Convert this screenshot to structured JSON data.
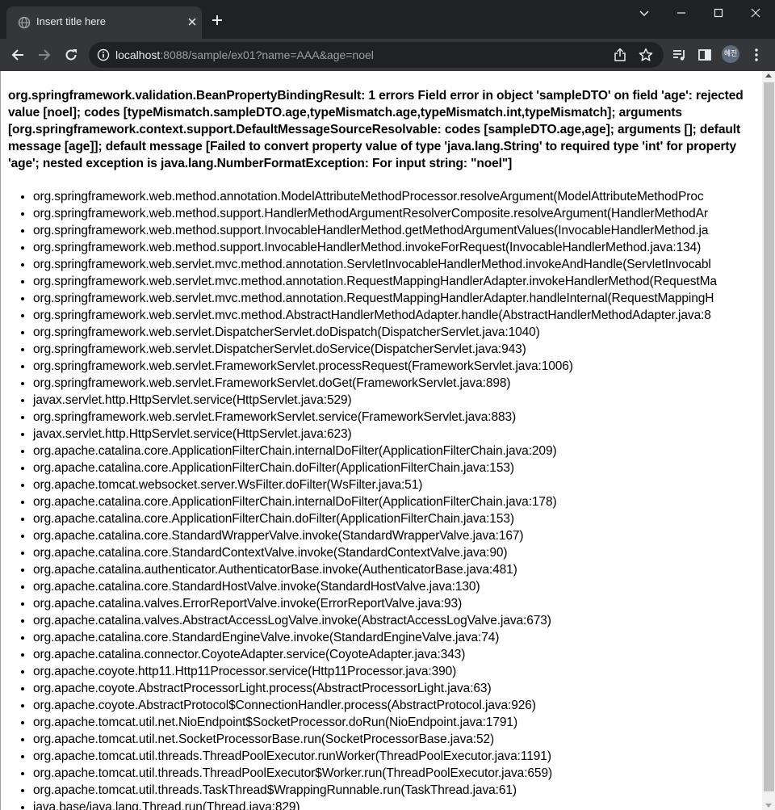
{
  "tab": {
    "title": "Insert title here",
    "favicon": "globe-icon"
  },
  "window_controls": [
    "chevron-down-icon",
    "minimize-icon",
    "maximize-icon",
    "close-icon"
  ],
  "address_bar": {
    "host": "localhost",
    "rest": ":8088/sample/ex01?name=AAA&age=noel"
  },
  "profile": {
    "initials": "혜진"
  },
  "colors": {
    "tabstrip": "#202124",
    "toolbar": "#35363a",
    "omnibox": "#202124",
    "text_light": "#e8eaed",
    "text_dim": "#9aa0a6"
  },
  "error": {
    "message": "org.springframework.validation.BeanPropertyBindingResult: 1 errors Field error in object 'sampleDTO' on field 'age': rejected value [noel]; codes [typeMismatch.sampleDTO.age,typeMismatch.age,typeMismatch.int,typeMismatch]; arguments [org.springframework.context.support.DefaultMessageSourceResolvable: codes [sampleDTO.age,age]; arguments []; default message [age]]; default message [Failed to convert property value of type 'java.lang.String' to required type 'int' for property 'age'; nested exception is java.lang.NumberFormatException: For input string: \"noel\"]"
  },
  "trace": [
    "org.springframework.web.method.annotation.ModelAttributeMethodProcessor.resolveArgument(ModelAttributeMethodProc",
    "org.springframework.web.method.support.HandlerMethodArgumentResolverComposite.resolveArgument(HandlerMethodAr",
    "org.springframework.web.method.support.InvocableHandlerMethod.getMethodArgumentValues(InvocableHandlerMethod.ja",
    "org.springframework.web.method.support.InvocableHandlerMethod.invokeForRequest(InvocableHandlerMethod.java:134)",
    "org.springframework.web.servlet.mvc.method.annotation.ServletInvocableHandlerMethod.invokeAndHandle(ServletInvocabl",
    "org.springframework.web.servlet.mvc.method.annotation.RequestMappingHandlerAdapter.invokeHandlerMethod(RequestMa",
    "org.springframework.web.servlet.mvc.method.annotation.RequestMappingHandlerAdapter.handleInternal(RequestMappingH",
    "org.springframework.web.servlet.mvc.method.AbstractHandlerMethodAdapter.handle(AbstractHandlerMethodAdapter.java:8",
    "org.springframework.web.servlet.DispatcherServlet.doDispatch(DispatcherServlet.java:1040)",
    "org.springframework.web.servlet.DispatcherServlet.doService(DispatcherServlet.java:943)",
    "org.springframework.web.servlet.FrameworkServlet.processRequest(FrameworkServlet.java:1006)",
    "org.springframework.web.servlet.FrameworkServlet.doGet(FrameworkServlet.java:898)",
    "javax.servlet.http.HttpServlet.service(HttpServlet.java:529)",
    "org.springframework.web.servlet.FrameworkServlet.service(FrameworkServlet.java:883)",
    "javax.servlet.http.HttpServlet.service(HttpServlet.java:623)",
    "org.apache.catalina.core.ApplicationFilterChain.internalDoFilter(ApplicationFilterChain.java:209)",
    "org.apache.catalina.core.ApplicationFilterChain.doFilter(ApplicationFilterChain.java:153)",
    "org.apache.tomcat.websocket.server.WsFilter.doFilter(WsFilter.java:51)",
    "org.apache.catalina.core.ApplicationFilterChain.internalDoFilter(ApplicationFilterChain.java:178)",
    "org.apache.catalina.core.ApplicationFilterChain.doFilter(ApplicationFilterChain.java:153)",
    "org.apache.catalina.core.StandardWrapperValve.invoke(StandardWrapperValve.java:167)",
    "org.apache.catalina.core.StandardContextValve.invoke(StandardContextValve.java:90)",
    "org.apache.catalina.authenticator.AuthenticatorBase.invoke(AuthenticatorBase.java:481)",
    "org.apache.catalina.core.StandardHostValve.invoke(StandardHostValve.java:130)",
    "org.apache.catalina.valves.ErrorReportValve.invoke(ErrorReportValve.java:93)",
    "org.apache.catalina.valves.AbstractAccessLogValve.invoke(AbstractAccessLogValve.java:673)",
    "org.apache.catalina.core.StandardEngineValve.invoke(StandardEngineValve.java:74)",
    "org.apache.catalina.connector.CoyoteAdapter.service(CoyoteAdapter.java:343)",
    "org.apache.coyote.http11.Http11Processor.service(Http11Processor.java:390)",
    "org.apache.coyote.AbstractProcessorLight.process(AbstractProcessorLight.java:63)",
    "org.apache.coyote.AbstractProtocol$ConnectionHandler.process(AbstractProtocol.java:926)",
    "org.apache.tomcat.util.net.NioEndpoint$SocketProcessor.doRun(NioEndpoint.java:1791)",
    "org.apache.tomcat.util.net.SocketProcessorBase.run(SocketProcessorBase.java:52)",
    "org.apache.tomcat.util.threads.ThreadPoolExecutor.runWorker(ThreadPoolExecutor.java:1191)",
    "org.apache.tomcat.util.threads.ThreadPoolExecutor$Worker.run(ThreadPoolExecutor.java:659)",
    "org.apache.tomcat.util.threads.TaskThread$WrappingRunnable.run(TaskThread.java:61)",
    "java.base/java.lang.Thread.run(Thread.java:829)"
  ]
}
